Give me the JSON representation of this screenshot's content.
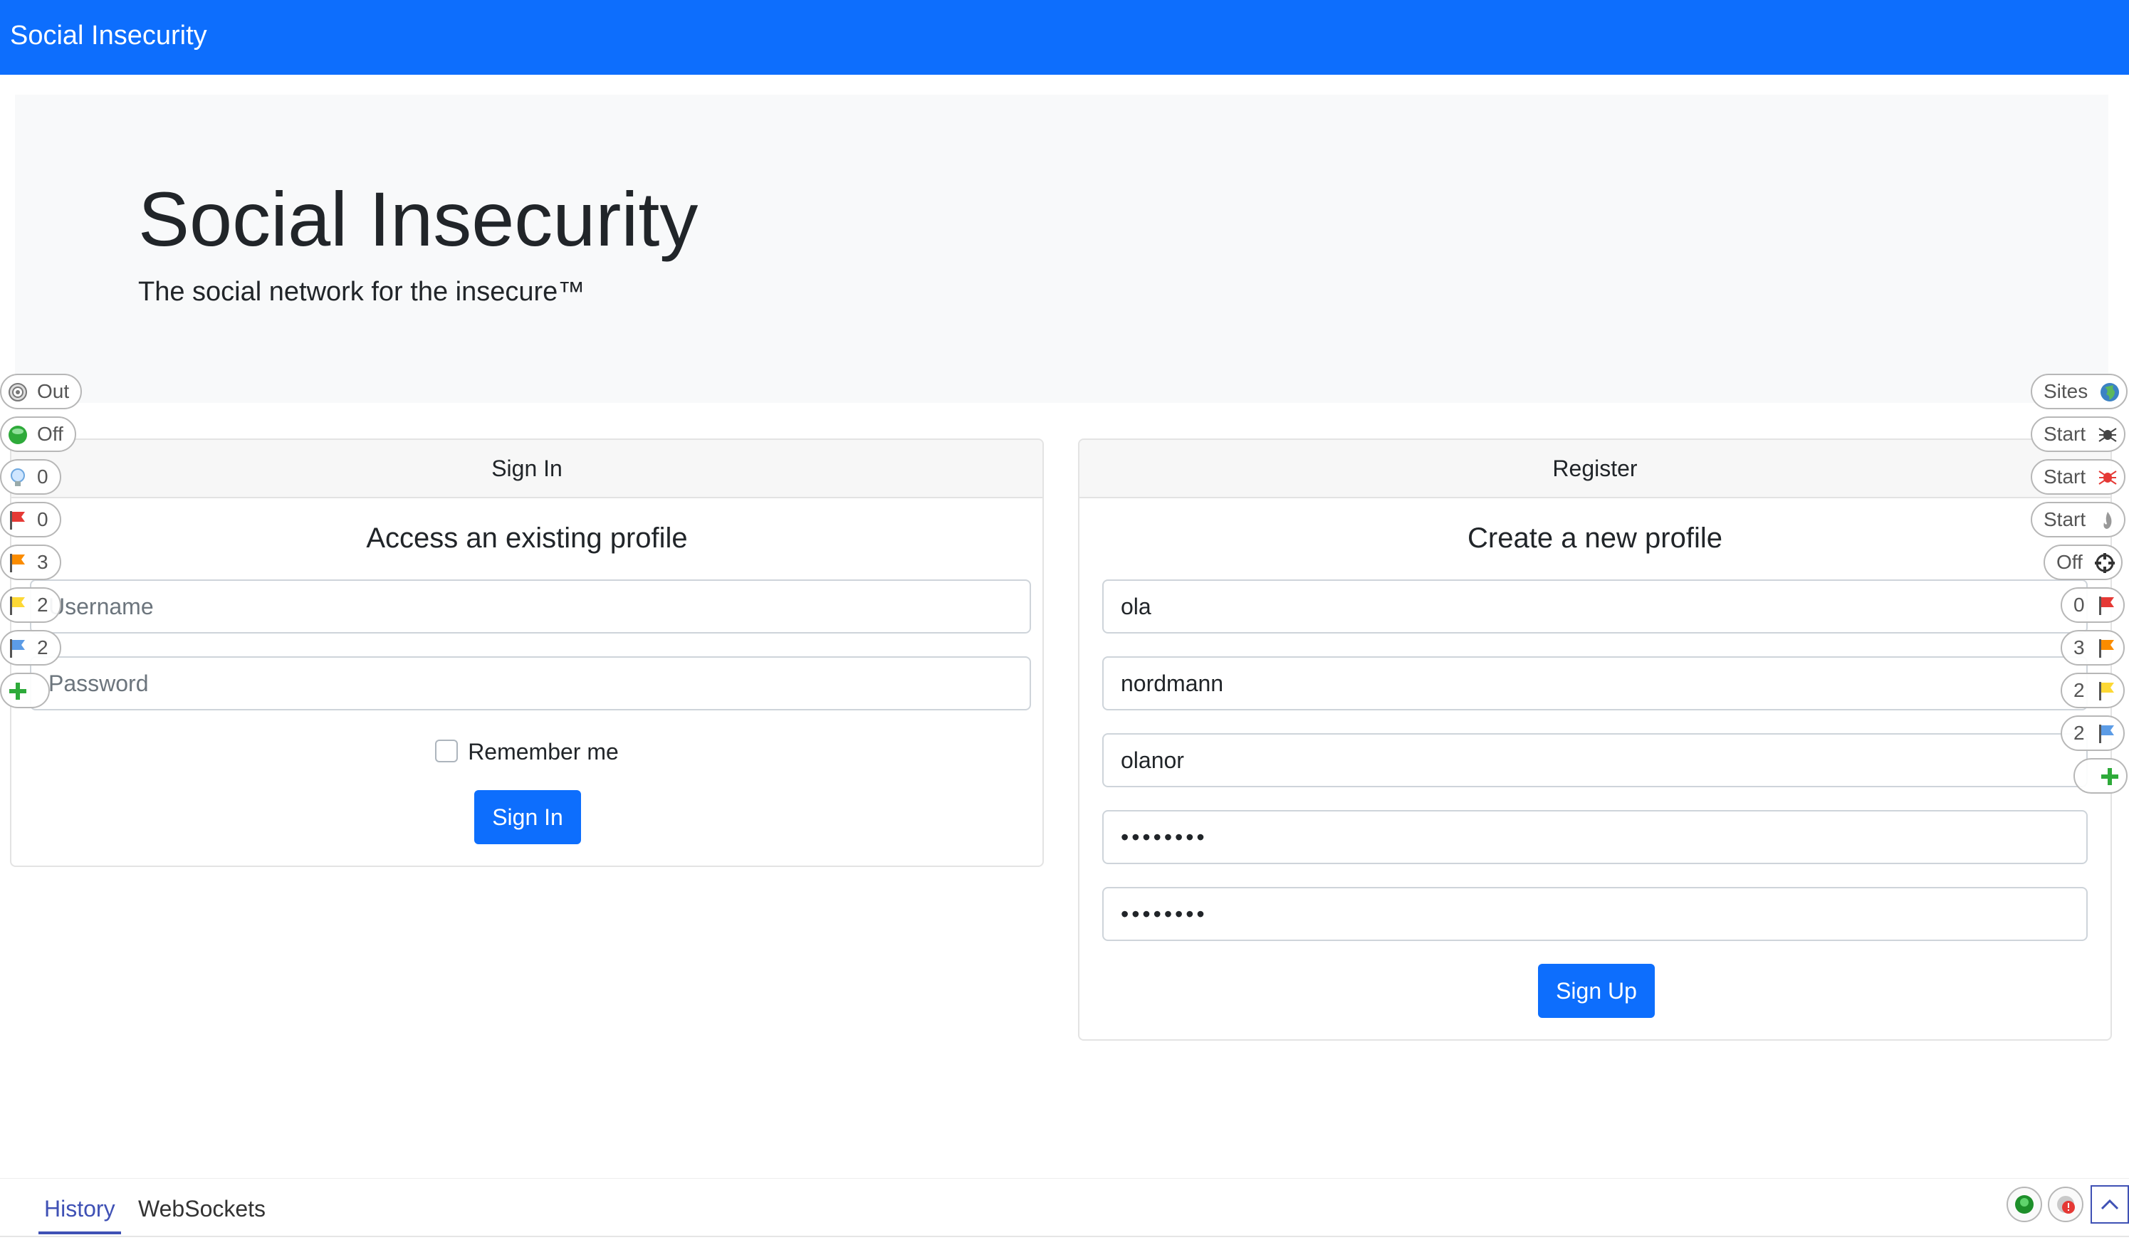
{
  "navbar": {
    "brand": "Social Insecurity"
  },
  "hero": {
    "title": "Social Insecurity",
    "lead": "The social network for the insecure™"
  },
  "signin": {
    "header": "Sign In",
    "title": "Access an existing profile",
    "username_placeholder": "Username",
    "password_placeholder": "Password",
    "remember_label": "Remember me",
    "button": "Sign In"
  },
  "register": {
    "header": "Register",
    "title": "Create a new profile",
    "first_name": "ola",
    "last_name": "nordmann",
    "username": "olanor",
    "password": "••••••••",
    "confirm_password": "••••••••",
    "button": "Sign Up"
  },
  "hud_left": [
    {
      "label": "Out",
      "icon": "target-icon"
    },
    {
      "label": "Off",
      "icon": "green-circle-icon"
    },
    {
      "label": "0",
      "icon": "lightbulb-icon"
    },
    {
      "label": "0",
      "icon": "red-flag-icon"
    },
    {
      "label": "3",
      "icon": "orange-flag-icon"
    },
    {
      "label": "2",
      "icon": "yellow-flag-icon"
    },
    {
      "label": "2",
      "icon": "blue-flag-icon"
    },
    {
      "label": "",
      "icon": "plus-icon"
    }
  ],
  "hud_right": [
    {
      "label": "Sites",
      "icon": "globe-icon"
    },
    {
      "label": "Start",
      "icon": "spider-icon"
    },
    {
      "label": "Start",
      "icon": "ajax-spider-icon"
    },
    {
      "label": "Start",
      "icon": "fire-icon"
    },
    {
      "label": "Off",
      "icon": "crosshair-icon"
    },
    {
      "label": "0",
      "icon": "red-flag-icon"
    },
    {
      "label": "3",
      "icon": "orange-flag-icon"
    },
    {
      "label": "2",
      "icon": "yellow-flag-icon"
    },
    {
      "label": "2",
      "icon": "blue-flag-icon"
    },
    {
      "label": "",
      "icon": "plus-icon"
    }
  ],
  "bottom_tabs": {
    "history": "History",
    "websockets": "WebSockets"
  },
  "colors": {
    "primary": "#0d6efd",
    "hud_accent": "#3f51b5",
    "jumbotron_bg": "#f8f9fa"
  }
}
